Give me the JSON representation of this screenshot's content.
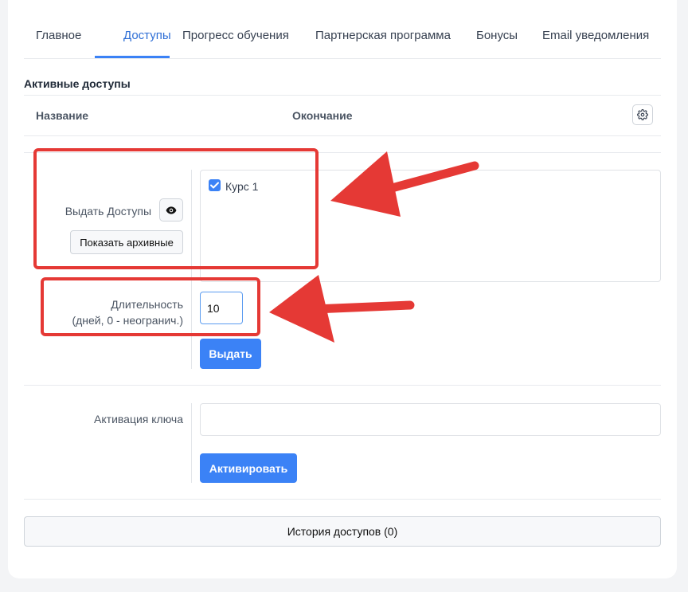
{
  "tabs": [
    {
      "label": "Главное",
      "active": false
    },
    {
      "label": "Доступы",
      "active": true
    },
    {
      "label": "Прогресс обучения",
      "active": false
    },
    {
      "label": "Партнерская программа",
      "active": false
    },
    {
      "label": "Бонусы",
      "active": false
    },
    {
      "label": "Email уведомления",
      "active": false
    }
  ],
  "active_access": {
    "title": "Активные доступы",
    "columns": [
      "Название",
      "Окончание"
    ],
    "settings_icon": "gear-icon"
  },
  "grant_form": {
    "grant_label": "Выдать Доступы",
    "show_archived_label": "Показать архивные",
    "view_icon": "eye-icon",
    "courses": [
      {
        "label": "Курс 1",
        "checked": true
      }
    ],
    "duration_label_line1": "Длительность",
    "duration_label_line2": "(дней, 0 - неогранич.)",
    "duration_value": "10",
    "grant_button": "Выдать"
  },
  "key_form": {
    "label": "Активация ключа",
    "value": "",
    "activate_button": "Активировать"
  },
  "history_button": "История доступов (0)",
  "colors": {
    "accent": "#3b82f6",
    "annotation": "#e53935"
  }
}
